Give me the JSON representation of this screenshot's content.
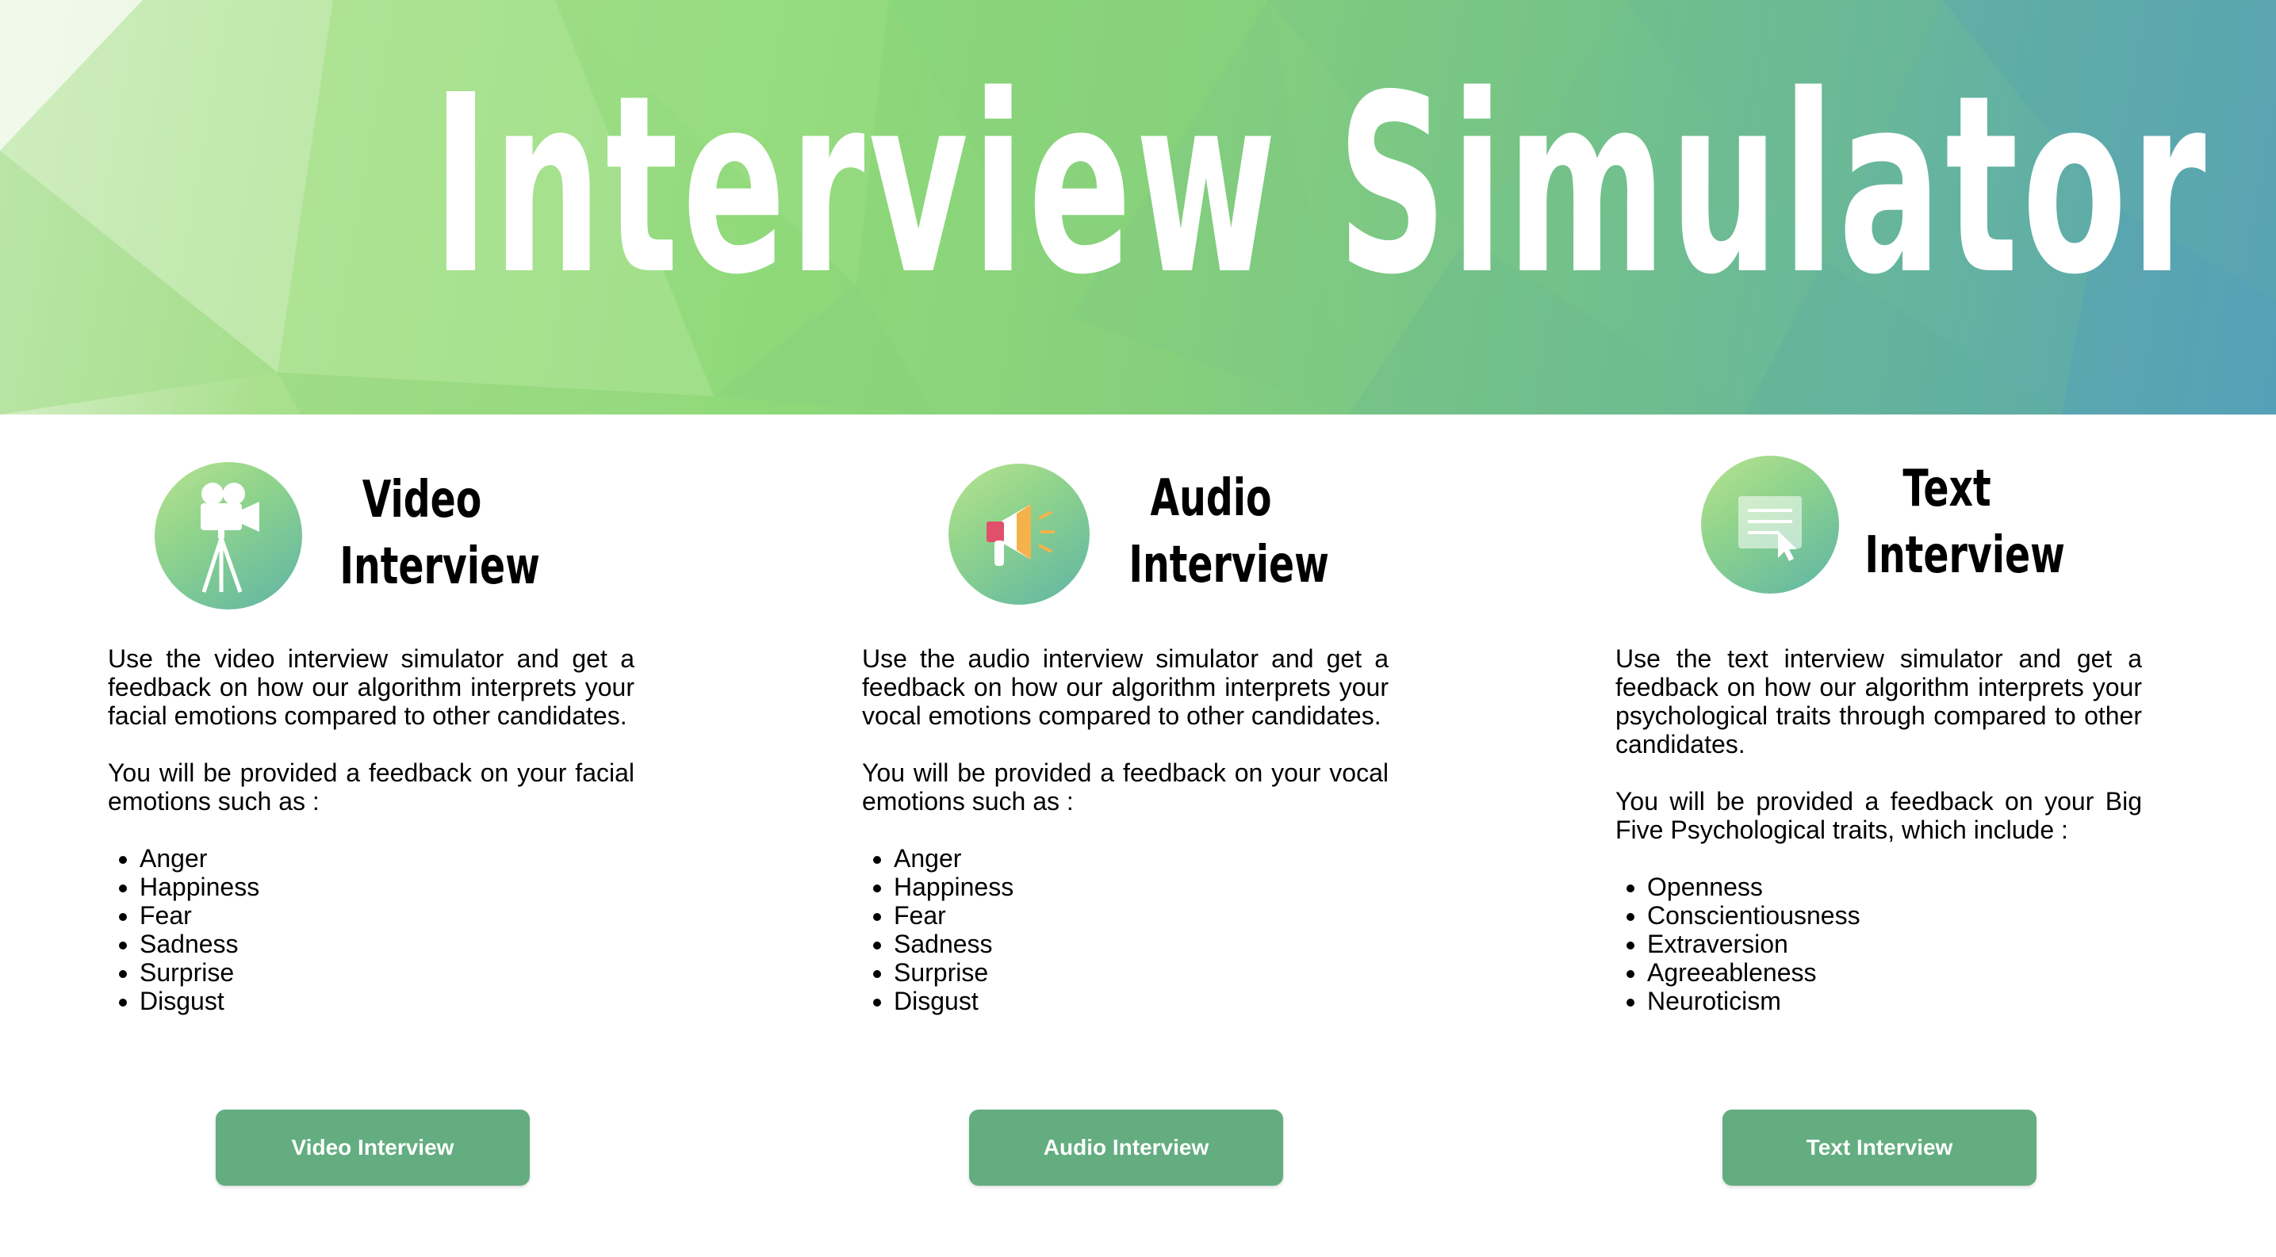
{
  "header": {
    "title": "Interview Simulator"
  },
  "cards": [
    {
      "icon": "video-camera-icon",
      "title_line1": "Video",
      "title_line2": "Interview",
      "description": "Use the video interview simulator and get a feedback on how our algorithm interprets your facial emotions compared to other candidates.",
      "feedback_intro": "You will be provided a feedback on your facial emotions such as :",
      "items": [
        "Anger",
        "Happiness",
        "Fear",
        "Sadness",
        "Surprise",
        "Disgust"
      ],
      "button_label": "Video Interview"
    },
    {
      "icon": "megaphone-icon",
      "title_line1": "Audio",
      "title_line2": "Interview",
      "description": "Use the audio interview simulator and get a feedback on how our algorithm interprets your vocal emotions compared to other candidates.",
      "feedback_intro": "You will be provided a feedback on your vocal emotions such as :",
      "items": [
        "Anger",
        "Happiness",
        "Fear",
        "Sadness",
        "Surprise",
        "Disgust"
      ],
      "button_label": "Audio Interview"
    },
    {
      "icon": "text-document-cursor-icon",
      "title_line1": "Text",
      "title_line2": "Interview",
      "description": "Use the text interview simulator and get a feedback on how our algorithm interprets your psychological traits through compared to other candidates.",
      "feedback_intro": "You will be provided a feedback on your Big Five Psychological traits, which include :",
      "items": [
        "Openness",
        "Conscientiousness",
        "Extraversion",
        "Agreeableness",
        "Neuroticism"
      ],
      "button_label": "Text Interview"
    }
  ],
  "colors": {
    "button": "#63ad80",
    "button_text": "#ffffff",
    "hero_start": "#dff2d3",
    "hero_end": "#58a2b6"
  }
}
